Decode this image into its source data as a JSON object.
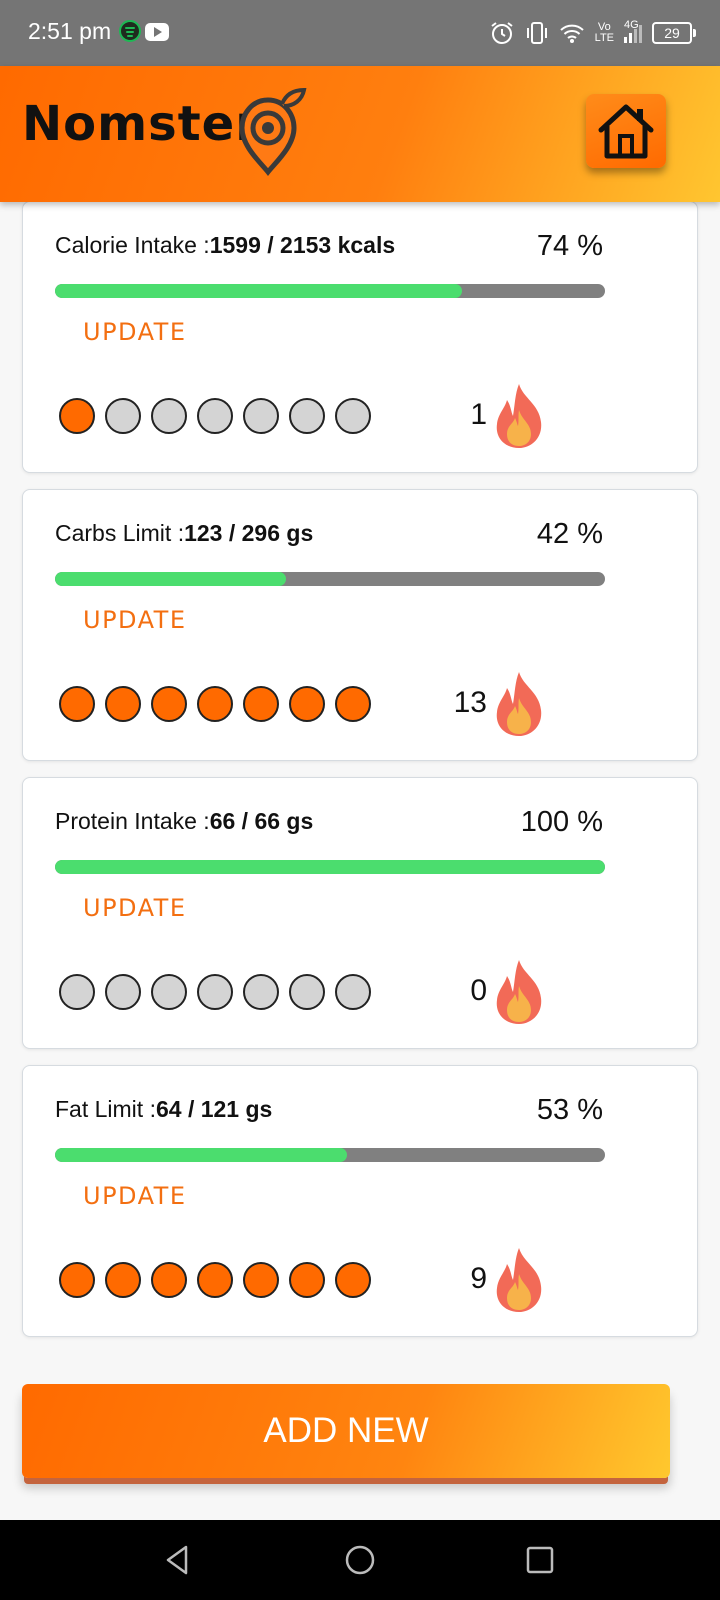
{
  "status_bar": {
    "time": "2:51 pm",
    "battery": "29",
    "network": "4G",
    "lte_top": "Vo",
    "lte_bottom": "LTE"
  },
  "app_bar": {
    "title": "Nomster"
  },
  "cards": [
    {
      "label": "Calorie Intake :",
      "value": "1599 / 2153 kcals",
      "percent_text": "74 %",
      "progress": 0.74,
      "update_label": "UPDATE",
      "days_done": [
        1,
        0,
        0,
        0,
        0,
        0,
        0
      ],
      "streak": "1"
    },
    {
      "label": "Carbs Limit :",
      "value": "123 / 296 gs",
      "percent_text": "42 %",
      "progress": 0.42,
      "update_label": "UPDATE",
      "days_done": [
        1,
        1,
        1,
        1,
        1,
        1,
        1
      ],
      "streak": "13"
    },
    {
      "label": "Protein Intake :",
      "value": "66 / 66 gs",
      "percent_text": "100 %",
      "progress": 1.0,
      "update_label": "UPDATE",
      "days_done": [
        0,
        0,
        0,
        0,
        0,
        0,
        0
      ],
      "streak": "0"
    },
    {
      "label": "Fat Limit :",
      "value": "64 / 121 gs",
      "percent_text": "53 %",
      "progress": 0.53,
      "update_label": "UPDATE",
      "days_done": [
        1,
        1,
        1,
        1,
        1,
        1,
        1
      ],
      "streak": "9"
    }
  ],
  "add_new_label": "ADD NEW",
  "colors": {
    "accent": "#ff6a00",
    "progress_fill": "#4bdd6e",
    "progress_track": "#808080",
    "dot_off": "#d4d4d4",
    "update_text": "#f36f11"
  },
  "icons": {
    "home": "home-icon",
    "flame": "flame-icon",
    "back": "back-triangle-icon",
    "home_nav": "home-circle-icon",
    "recents": "recents-square-icon"
  }
}
